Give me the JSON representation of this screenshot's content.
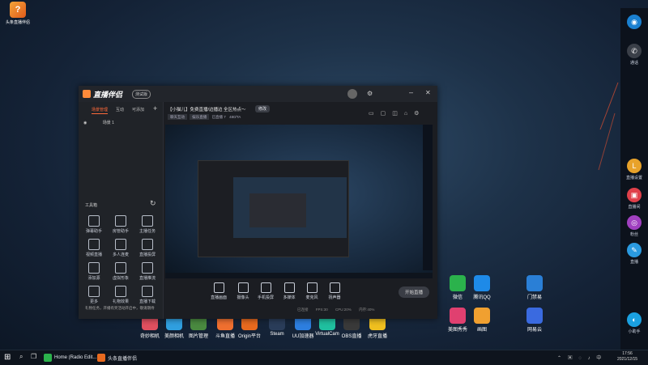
{
  "desktop": {
    "top_left_icon_label": "头条直播伴侣",
    "icons": [
      {
        "label": "微信",
        "color": "#2bb24c"
      },
      {
        "label": "腾讯QQ",
        "color": "#1e8ae8"
      },
      {
        "label": "门禁易",
        "color": "#2a7fd6"
      },
      {
        "label": "美图秀秀",
        "color": "#e04070"
      },
      {
        "label": "画图",
        "color": "#f0a030"
      },
      {
        "label": "网易云",
        "color": "#3a6ae0"
      },
      {
        "label": "奇妙相机",
        "color": "#e05060"
      },
      {
        "label": "美颜相机",
        "color": "#30a0e0"
      },
      {
        "label": "图片管理",
        "color": "#4a8a40"
      },
      {
        "label": "斗鱼直播",
        "color": "#f07030"
      },
      {
        "label": "Origin平台",
        "color": "#e86a1f"
      },
      {
        "label": "Steam",
        "color": "#2a3d5a"
      },
      {
        "label": "UU加速器",
        "color": "#2d7fe0"
      },
      {
        "label": "VirtualCam",
        "color": "#20c0a0"
      },
      {
        "label": "OBS直播",
        "color": "#3a3a3a"
      },
      {
        "label": "虎牙直播",
        "color": "#f0c020"
      }
    ]
  },
  "dock": {
    "items": [
      {
        "label": "",
        "color": "#1a80d0",
        "glyph": "◉"
      },
      {
        "label": "通话",
        "color": "#3a3f48",
        "glyph": "✆"
      },
      {
        "label": "直播设置",
        "color": "#e8a22a",
        "glyph": "L"
      },
      {
        "label": "直播间",
        "color": "#e0404a",
        "glyph": "▣"
      },
      {
        "label": "粉丝",
        "color": "#a040c0",
        "glyph": "◎"
      },
      {
        "label": "直播",
        "color": "#2a9ae0",
        "glyph": "✎"
      },
      {
        "label": "小助手",
        "color": "#1aa0e0",
        "glyph": "◐"
      }
    ]
  },
  "app": {
    "logo_text": "直播伴侣",
    "badge": "测试版",
    "tabs": [
      "场景管理",
      "互动",
      "可添加"
    ],
    "scene": "场景 1",
    "stream_title": "【小猫儿】免费直播/边播边 全区热点～",
    "edit_button": "修改",
    "tags": [
      "聊天互动",
      "娱乐直播",
      "已直播 7",
      "480/TA"
    ],
    "toolbox_title": "工具箱",
    "tools": [
      {
        "label": "弹幕助手"
      },
      {
        "label": "房管助手"
      },
      {
        "label": "主播任务"
      },
      {
        "label": "视频直播"
      },
      {
        "label": "多人连麦"
      },
      {
        "label": "直播投屏"
      },
      {
        "label": "添加源"
      },
      {
        "label": "虚拟形象"
      },
      {
        "label": "直播推流"
      },
      {
        "label": "更多"
      },
      {
        "label": "礼物效果"
      },
      {
        "label": "直播下载"
      }
    ],
    "notice": "礼物任务，开播有奖活动开启中，敬请期待",
    "controls": [
      {
        "label": "直播画面"
      },
      {
        "label": "摄像头"
      },
      {
        "label": "手机投屏"
      },
      {
        "label": "多媒体"
      },
      {
        "label": "麦克风"
      },
      {
        "label": "扬声器"
      }
    ],
    "start_button": "开始直播",
    "status_items": [
      "已连接",
      "FPS:30",
      "CPU:20%",
      "内存:40%"
    ]
  },
  "taskbar": {
    "items": [
      {
        "label": "Home (Radio Edit...",
        "color": "#2bb24c"
      },
      {
        "label": "头条直播伴侣",
        "color": "#e86a1f"
      }
    ],
    "time": "17:56",
    "date": "2021/12/15"
  }
}
